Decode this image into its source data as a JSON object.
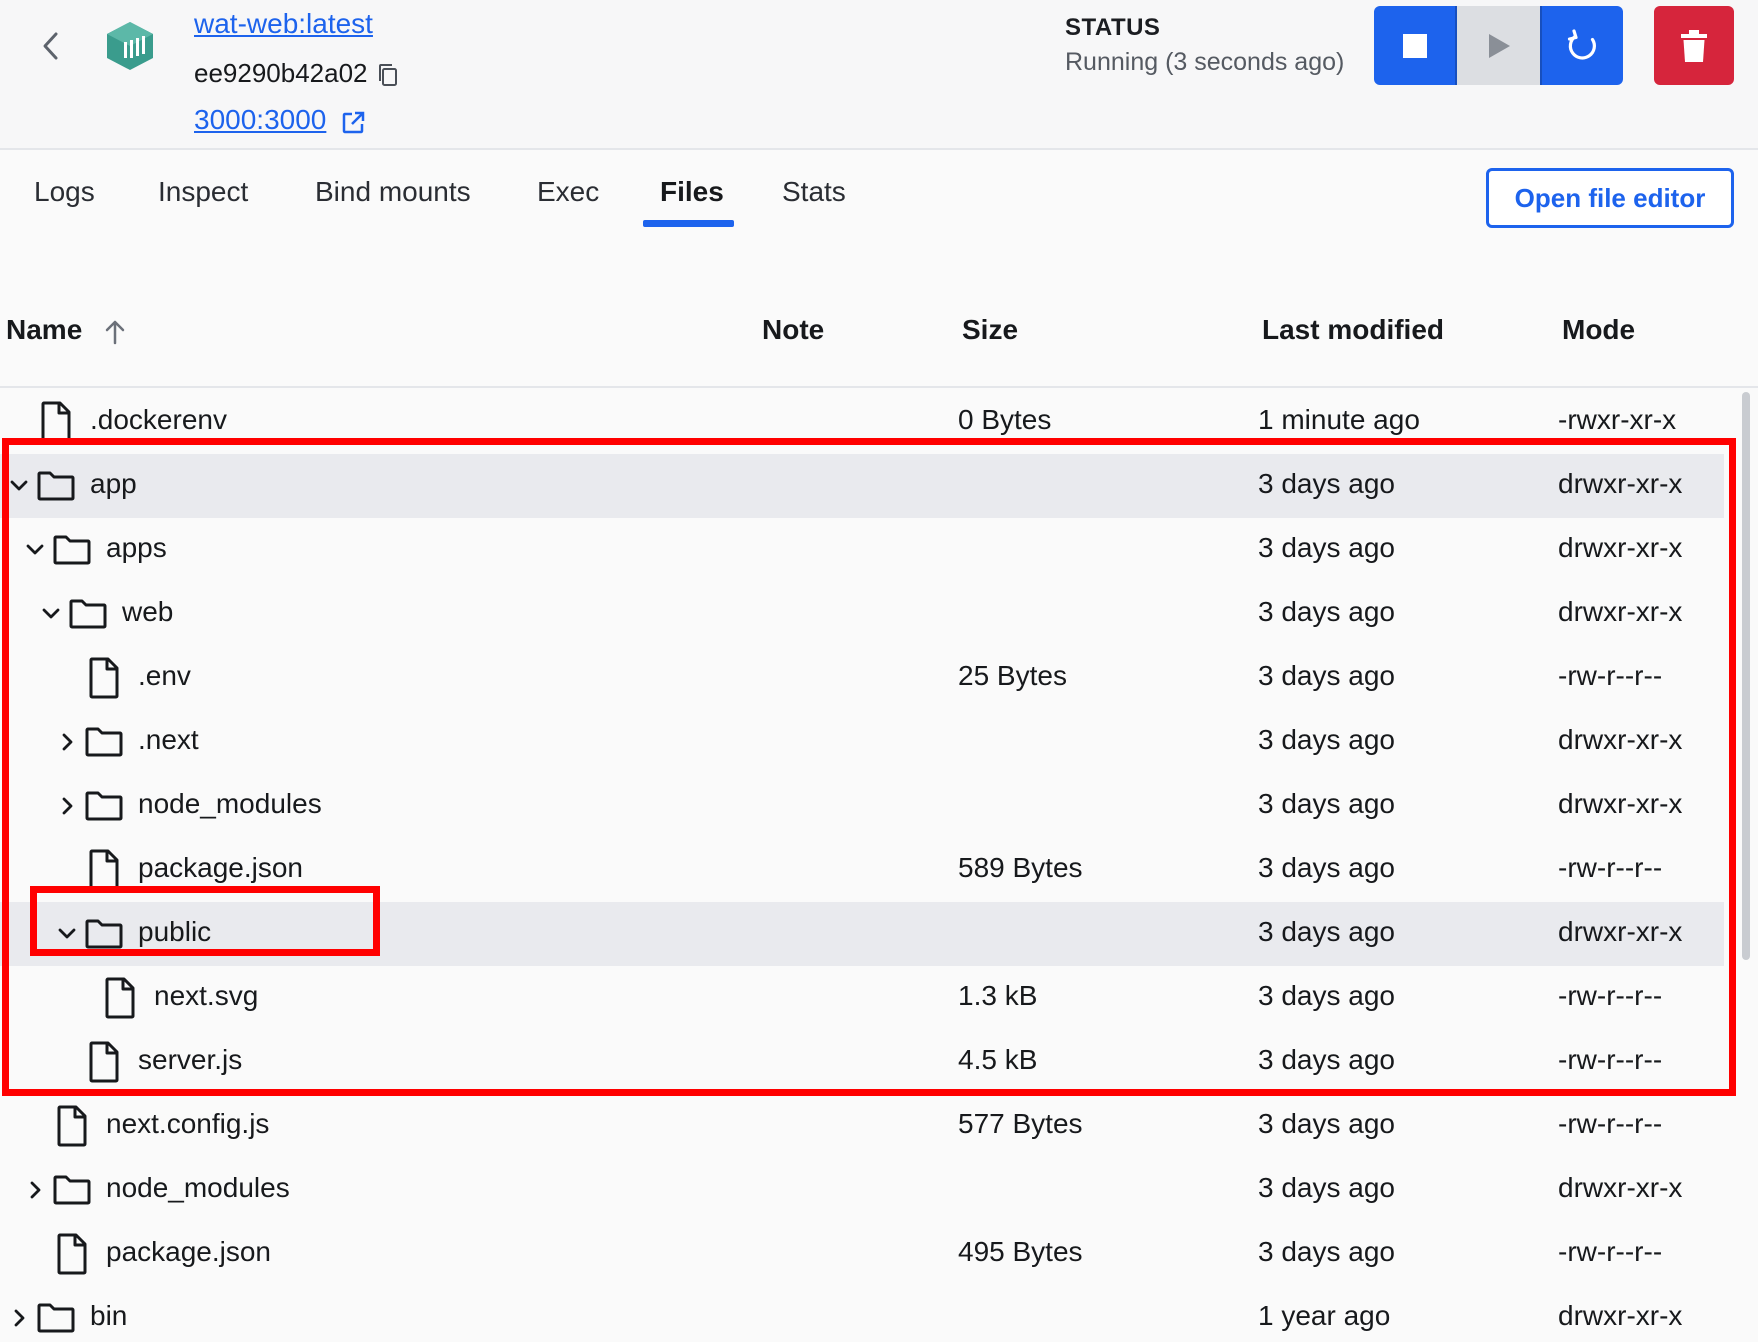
{
  "header": {
    "image_link": "wat-web:latest",
    "container_id": "ee9290b42a02",
    "port_link": "3000:3000",
    "status_label": "STATUS",
    "status_text": "Running (3 seconds ago)",
    "brand_color": "#1d63ed",
    "danger_color": "#d6253c",
    "icon_color": "#3a9c8d"
  },
  "tabs": [
    {
      "label": "Logs"
    },
    {
      "label": "Inspect"
    },
    {
      "label": "Bind mounts"
    },
    {
      "label": "Exec"
    },
    {
      "label": "Files",
      "active": true
    },
    {
      "label": "Stats"
    }
  ],
  "open_editor_label": "Open file editor",
  "table": {
    "columns": {
      "name": "Name",
      "note": "Note",
      "size": "Size",
      "modified": "Last modified",
      "mode": "Mode"
    },
    "sort": "ascending",
    "rows": [
      {
        "name": ".dockerenv",
        "type": "file",
        "depth": 0,
        "size": "0 Bytes",
        "modified": "1 minute ago",
        "mode": "-rwxr-xr-x"
      },
      {
        "name": "app",
        "type": "folder",
        "depth": 0,
        "expanded": true,
        "size": "",
        "modified": "3 days ago",
        "mode": "drwxr-xr-x",
        "selected": true
      },
      {
        "name": "apps",
        "type": "folder",
        "depth": 1,
        "expanded": true,
        "size": "",
        "modified": "3 days ago",
        "mode": "drwxr-xr-x"
      },
      {
        "name": "web",
        "type": "folder",
        "depth": 2,
        "expanded": true,
        "size": "",
        "modified": "3 days ago",
        "mode": "drwxr-xr-x"
      },
      {
        "name": ".env",
        "type": "file",
        "depth": 3,
        "size": "25 Bytes",
        "modified": "3 days ago",
        "mode": "-rw-r--r--"
      },
      {
        "name": ".next",
        "type": "folder",
        "depth": 3,
        "expanded": false,
        "size": "",
        "modified": "3 days ago",
        "mode": "drwxr-xr-x"
      },
      {
        "name": "node_modules",
        "type": "folder",
        "depth": 3,
        "expanded": false,
        "size": "",
        "modified": "3 days ago",
        "mode": "drwxr-xr-x"
      },
      {
        "name": "package.json",
        "type": "file",
        "depth": 3,
        "size": "589 Bytes",
        "modified": "3 days ago",
        "mode": "-rw-r--r--"
      },
      {
        "name": "public",
        "type": "folder",
        "depth": 3,
        "expanded": true,
        "size": "",
        "modified": "3 days ago",
        "mode": "drwxr-xr-x",
        "selected": true
      },
      {
        "name": "next.svg",
        "type": "file",
        "depth": 4,
        "size": "1.3 kB",
        "modified": "3 days ago",
        "mode": "-rw-r--r--"
      },
      {
        "name": "server.js",
        "type": "file",
        "depth": 3,
        "size": "4.5 kB",
        "modified": "3 days ago",
        "mode": "-rw-r--r--"
      },
      {
        "name": "next.config.js",
        "type": "file",
        "depth": 1,
        "size": "577 Bytes",
        "modified": "3 days ago",
        "mode": "-rw-r--r--"
      },
      {
        "name": "node_modules",
        "type": "folder",
        "depth": 1,
        "expanded": false,
        "size": "",
        "modified": "3 days ago",
        "mode": "drwxr-xr-x"
      },
      {
        "name": "package.json",
        "type": "file",
        "depth": 1,
        "size": "495 Bytes",
        "modified": "3 days ago",
        "mode": "-rw-r--r--"
      },
      {
        "name": "bin",
        "type": "folder",
        "depth": 0,
        "expanded": false,
        "size": "",
        "modified": "1 year ago",
        "mode": "drwxr-xr-x"
      }
    ]
  }
}
